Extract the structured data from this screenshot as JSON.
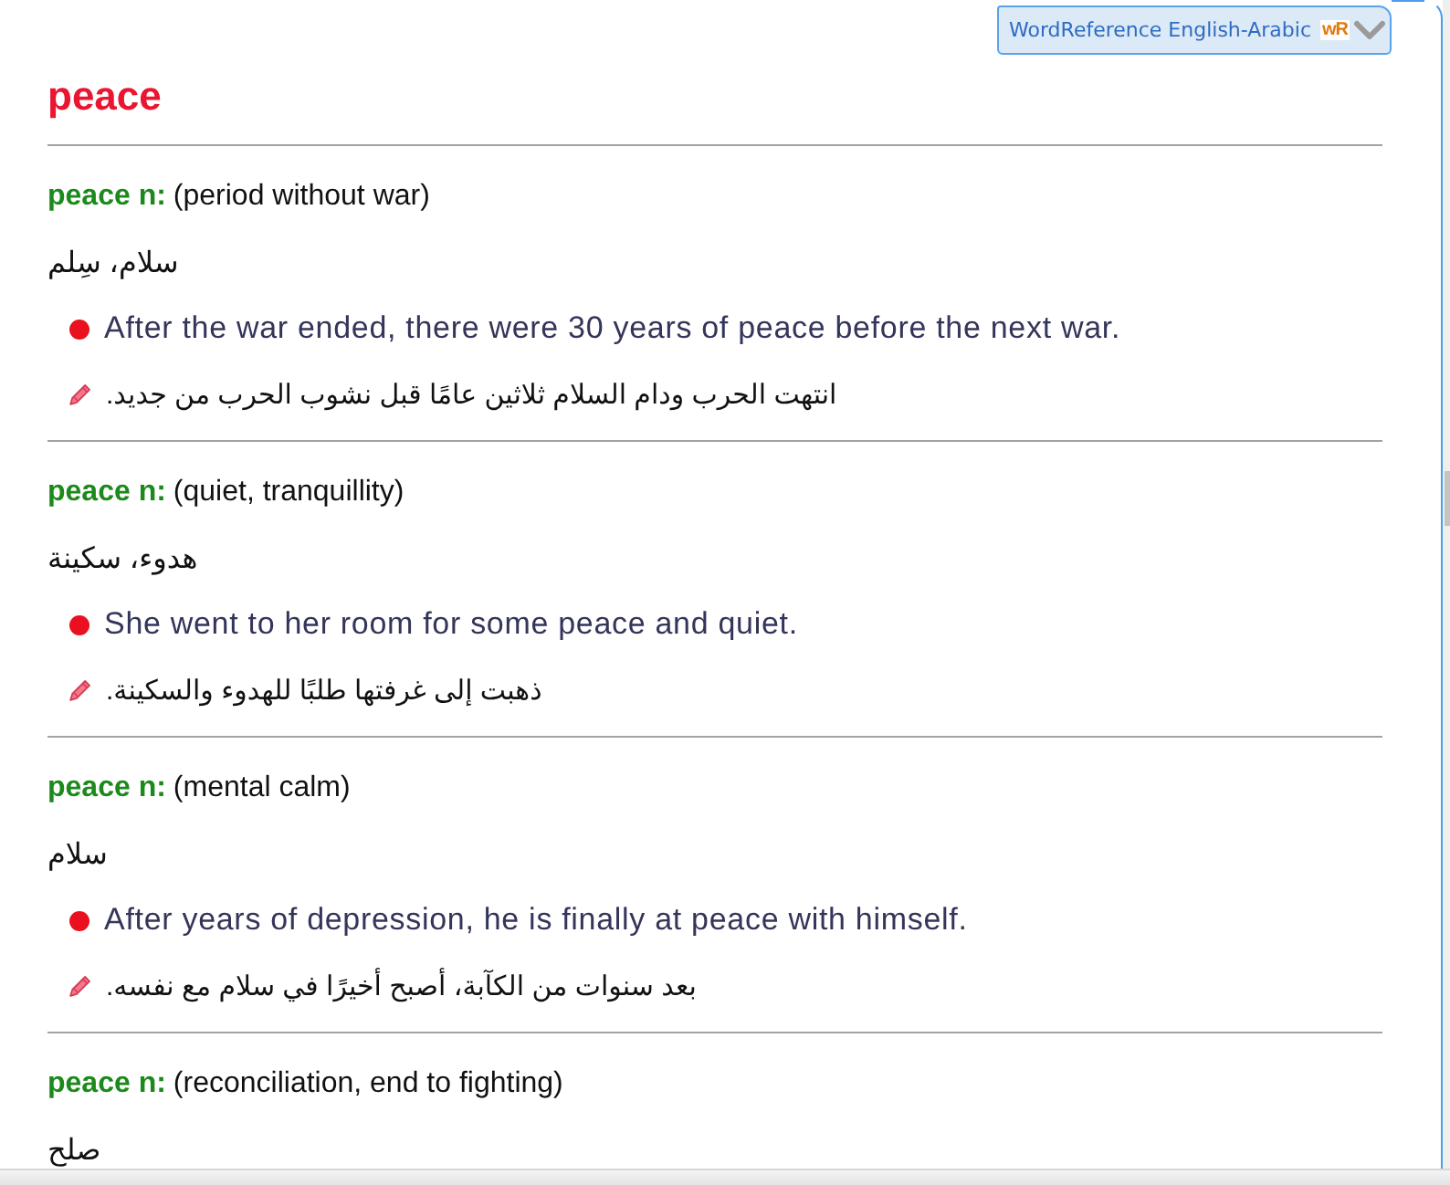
{
  "dictionary_selector": {
    "label": "WordReference English-Arabic",
    "logo": "wR"
  },
  "headword": "peace",
  "entries": [
    {
      "term": "peace n:",
      "sense": "(period without war)",
      "translation": "سلام، سِلم",
      "example": "After the war ended, there were 30 years of peace before the next war.",
      "example_translation": "انتهت الحرب ودام السلام ثلاثين عامًا قبل نشوب الحرب من جديد."
    },
    {
      "term": "peace n:",
      "sense": "(quiet, tranquillity)",
      "translation": "هدوء، سكينة",
      "example": "She went to her room for some peace and quiet.",
      "example_translation": "ذهبت إلى غرفتها طلبًا للهدوء والسكينة."
    },
    {
      "term": "peace n:",
      "sense": "(mental calm)",
      "translation": "سلام",
      "example": "After years of depression, he is finally at peace with himself.",
      "example_translation": "بعد سنوات من الكآبة، أصبح أخيرًا في سلام مع نفسه."
    },
    {
      "term": "peace n:",
      "sense": "(reconciliation, end to fighting)",
      "translation": "صلح"
    }
  ]
}
